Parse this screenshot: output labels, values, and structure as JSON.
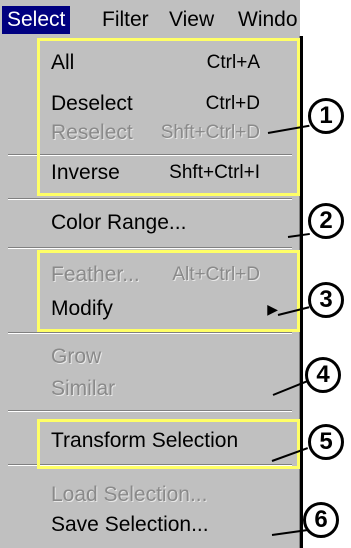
{
  "menubar": {
    "select": "Select",
    "filter": "Filter",
    "view": "View",
    "window": "Windo"
  },
  "menu": {
    "all": {
      "label": "All",
      "shortcut": "Ctrl+A"
    },
    "deselect": {
      "label": "Deselect",
      "shortcut": "Ctrl+D"
    },
    "reselect": {
      "label": "Reselect",
      "shortcut": "Shft+Ctrl+D"
    },
    "inverse": {
      "label": "Inverse",
      "shortcut": "Shft+Ctrl+I"
    },
    "color_range": {
      "label": "Color Range..."
    },
    "feather": {
      "label": "Feather...",
      "shortcut": "Alt+Ctrl+D"
    },
    "modify": {
      "label": "Modify"
    },
    "grow": {
      "label": "Grow"
    },
    "similar": {
      "label": "Similar"
    },
    "transform_selection": {
      "label": "Transform Selection"
    },
    "load_selection": {
      "label": "Load Selection..."
    },
    "save_selection": {
      "label": "Save Selection..."
    }
  },
  "callouts": [
    "1",
    "2",
    "3",
    "4",
    "5",
    "6"
  ],
  "colors": {
    "menu_bg": "#c0c0c0",
    "active_bg": "#000080",
    "highlight": "#ffff66",
    "disabled_text": "#8a8a8a"
  }
}
